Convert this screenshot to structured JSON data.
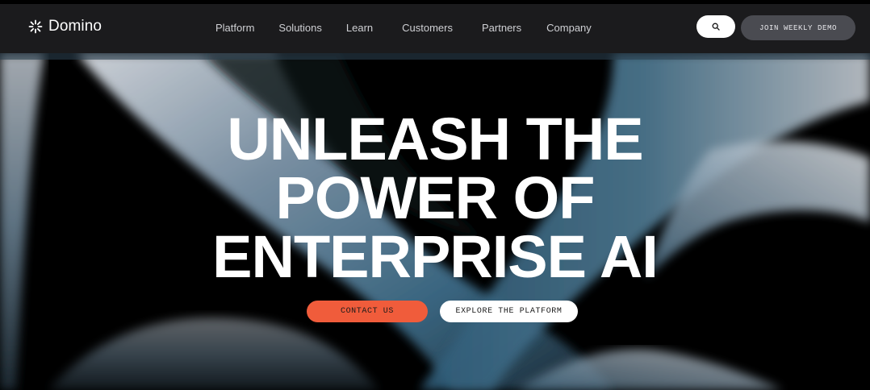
{
  "brand": {
    "name": "Domino",
    "logo_icon": "domino-logo-icon"
  },
  "nav": {
    "items": [
      {
        "label": "Platform"
      },
      {
        "label": "Solutions"
      },
      {
        "label": "Learn"
      },
      {
        "label": "Customers"
      },
      {
        "label": "Partners"
      },
      {
        "label": "Company"
      }
    ],
    "search_icon": "search-icon",
    "demo_label": "JOIN WEEKLY DEMO"
  },
  "hero": {
    "title_lines": [
      "UNLEASH THE",
      "POWER OF",
      "ENTERPRISE AI"
    ],
    "primary_cta": "CONTACT US",
    "secondary_cta": "EXPLORE THE PLATFORM"
  },
  "colors": {
    "nav_background": "#1b1b1d",
    "hero_background": "#000000",
    "demo_button": "#4a4b51",
    "primary_cta": "#f05c3b",
    "secondary_cta": "#ffffff",
    "ribbon_teal": "#3f6f8a",
    "ribbon_silver": "#c7ccd3"
  }
}
